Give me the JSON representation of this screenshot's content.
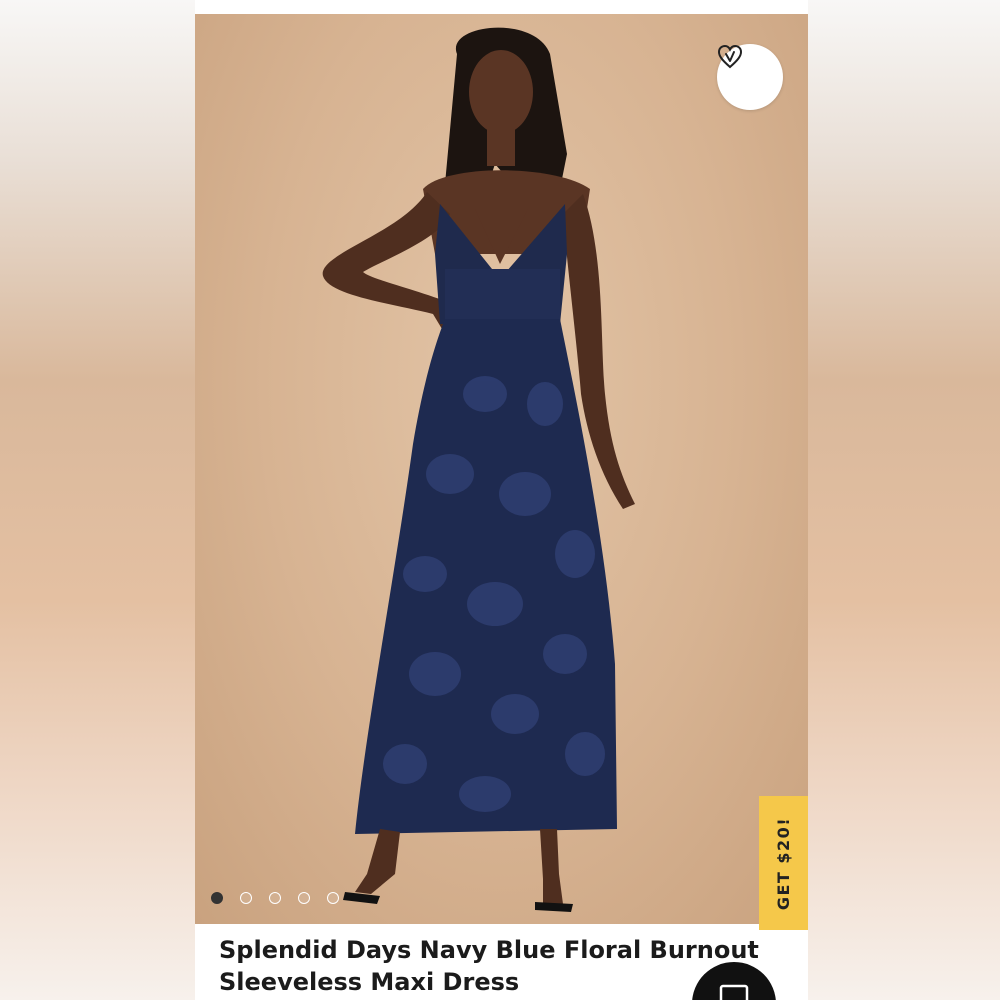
{
  "product": {
    "title": "Splendid Days Navy Blue Floral Burnout Sleeveless Maxi Dress",
    "image_alt": "Model wearing navy blue floral burnout sleeveless maxi dress"
  },
  "badges": {
    "promo_label": "GET $20!"
  },
  "carousel": {
    "count": 5,
    "active_index": 0
  },
  "icons": {
    "favorite": "heart-icon",
    "chat": "chat-icon"
  },
  "colors": {
    "promo": "#f5c84a",
    "dress": "#1f2a4d",
    "backdrop": "#d9b796"
  }
}
